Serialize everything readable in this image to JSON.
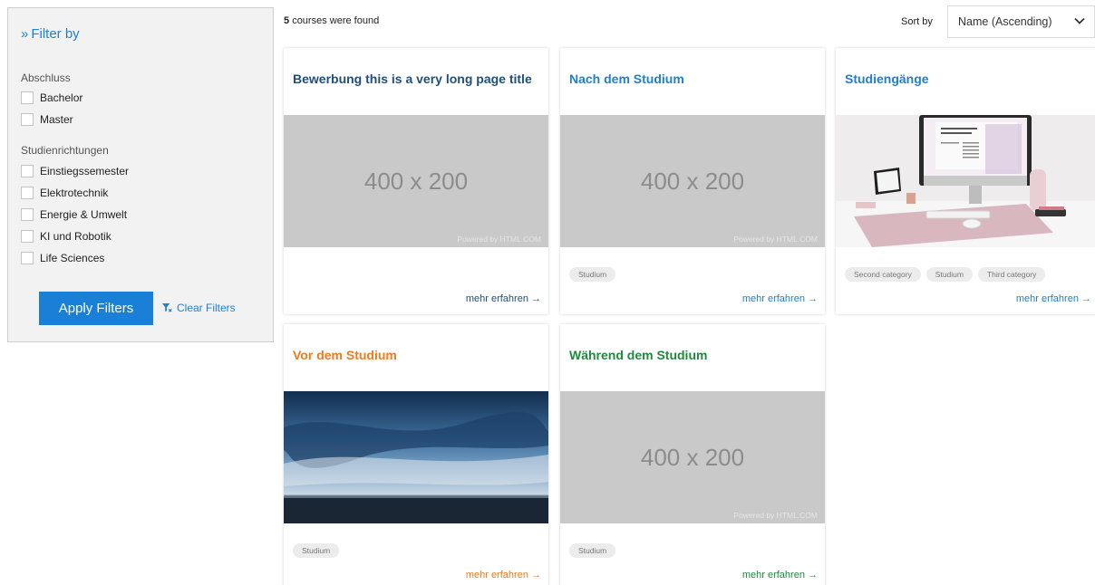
{
  "filter": {
    "title": "Filter by",
    "groups": [
      {
        "label": "Abschluss",
        "options": [
          "Bachelor",
          "Master"
        ]
      },
      {
        "label": "Studienrichtungen",
        "options": [
          "Einstiegssemester",
          "Elektrotechnik",
          "Energie & Umwelt",
          "KI und Robotik",
          "Life Sciences"
        ]
      }
    ],
    "apply_label": "Apply Filters",
    "clear_label": "Clear Filters"
  },
  "results": {
    "count": "5",
    "suffix": "courses were found"
  },
  "sort": {
    "label": "Sort by",
    "selected": "Name (Ascending)"
  },
  "placeholder": {
    "size_text": "400 x 200",
    "powered_by": "Powered by HTML.COM"
  },
  "colors": {
    "accent_blue": "#1f7fd2",
    "dark_blue": "#1f4f7a",
    "orange": "#f07a1e",
    "green": "#1e8a3e",
    "button_blue": "#1a7fd6"
  },
  "cards": [
    {
      "title": "Bewerbung this is a very long page title",
      "tags": [],
      "link": "mehr erfahren →",
      "image": "placeholder"
    },
    {
      "title": "Nach dem Studium",
      "tags": [
        "Studium"
      ],
      "link": "mehr erfahren →",
      "image": "placeholder"
    },
    {
      "title": "Studiengänge",
      "tags": [
        "Second category",
        "Studium",
        "Third category"
      ],
      "link": "mehr erfahren →",
      "image": "desk-photo"
    },
    {
      "title": "Vor dem Studium",
      "tags": [
        "Studium"
      ],
      "link": "mehr erfahren →",
      "image": "sea-photo"
    },
    {
      "title": "Während dem Studium",
      "tags": [
        "Studium"
      ],
      "link": "mehr erfahren →",
      "image": "placeholder"
    }
  ]
}
